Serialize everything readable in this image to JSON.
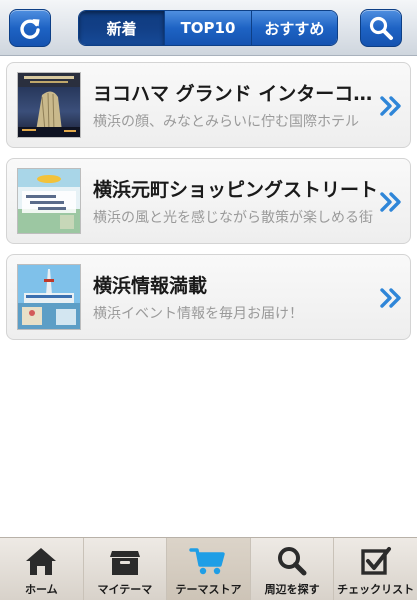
{
  "header": {
    "segments": [
      "新着",
      "TOP10",
      "おすすめ"
    ],
    "active_segment": "新着"
  },
  "items": [
    {
      "title": "ヨコハマ グランド インターコンチネンタル ホテル",
      "description": "横浜の顔、みなとみらいに佇む国際ホテル"
    },
    {
      "title": "横浜元町ショッピングストリート",
      "description": "横浜の風と光を感じながら散策が楽しめる街"
    },
    {
      "title": "横浜情報満載",
      "description": "横浜イベント情報を毎月お届け！"
    }
  ],
  "tabbar": [
    {
      "label": "ホーム",
      "icon": "home-icon"
    },
    {
      "label": "マイテーマ",
      "icon": "box-icon"
    },
    {
      "label": "テーマストア",
      "icon": "cart-icon"
    },
    {
      "label": "周辺を探す",
      "icon": "magnifier-icon"
    },
    {
      "label": "チェックリスト",
      "icon": "checklist-icon"
    }
  ],
  "active_tab": "テーマストア",
  "colors": {
    "accent_blue": "#1e63c4",
    "cart_blue": "#1f9ee6",
    "chevron_blue": "#2f86d8"
  }
}
